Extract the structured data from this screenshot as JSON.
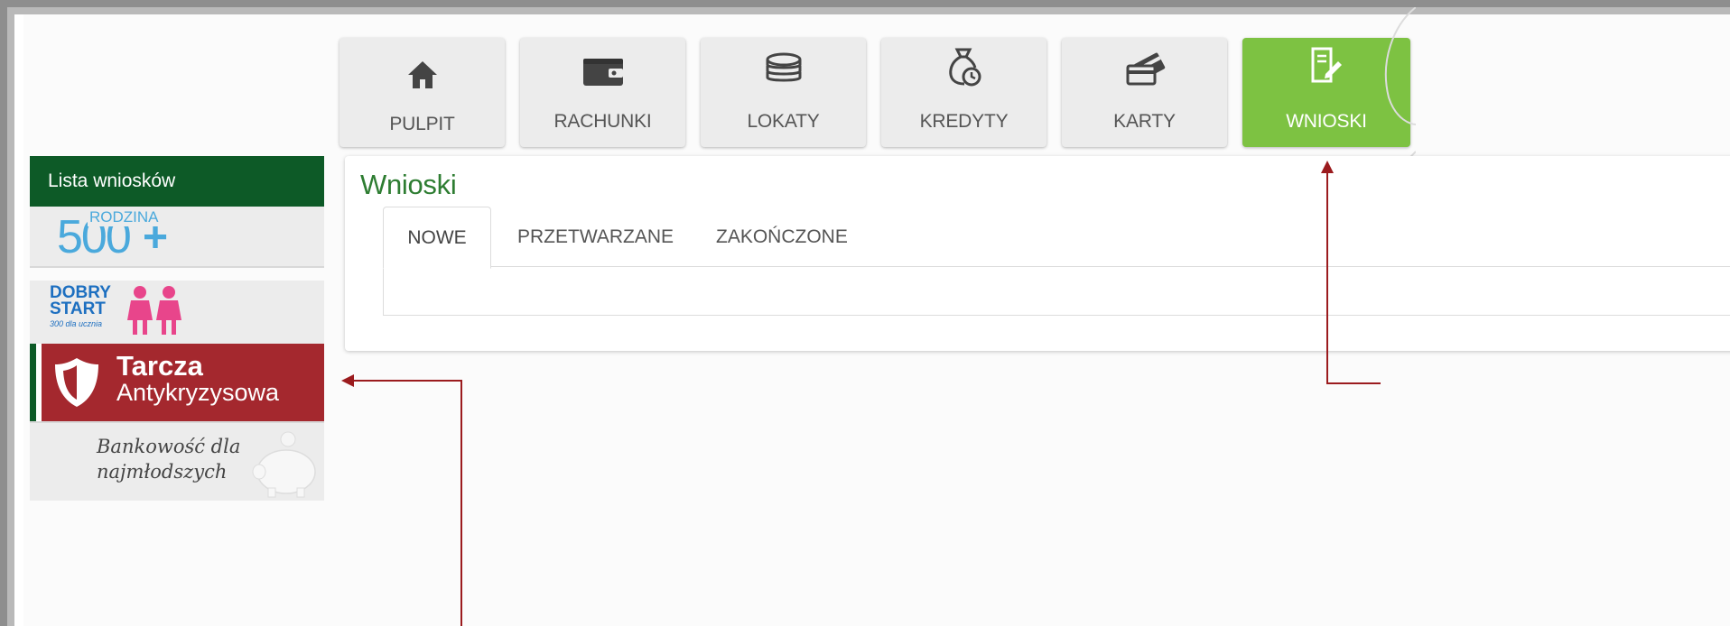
{
  "nav": {
    "items": [
      {
        "label": "PULPIT",
        "icon": "home-icon"
      },
      {
        "label": "RACHUNKI",
        "icon": "wallet-icon"
      },
      {
        "label": "LOKATY",
        "icon": "coins-icon"
      },
      {
        "label": "KREDYTY",
        "icon": "money-bag-clock-icon"
      },
      {
        "label": "KARTY",
        "icon": "cards-icon"
      },
      {
        "label": "WNIOSKI",
        "icon": "application-edit-icon",
        "active": true
      }
    ]
  },
  "sidebar": {
    "header": "Lista wniosków",
    "items": {
      "rodzina_number": "500",
      "rodzina_plus": "+",
      "rodzina_word": "RODZINA",
      "dobry_line1": "DOBRY",
      "dobry_line2": "START",
      "dobry_line3": "300 dla ucznia",
      "tarcza_line1": "Tarcza",
      "tarcza_line2": "Antykryzysowa",
      "bank_line1": "Bankowość dla",
      "bank_line2": "najmłodszych"
    }
  },
  "panel": {
    "title": "Wnioski",
    "tabs": [
      "NOWE",
      "PRZETWARZANE",
      "ZAKOŃCZONE"
    ]
  },
  "colors": {
    "active_green": "#7dc242",
    "dark_green": "#0d5a27",
    "tarcza_red": "#a4282e",
    "annotation_red": "#9b1b1e",
    "blue_500": "#4aa9dc",
    "dobry_blue": "#1d6fc0",
    "dobry_pink": "#e8458b"
  }
}
